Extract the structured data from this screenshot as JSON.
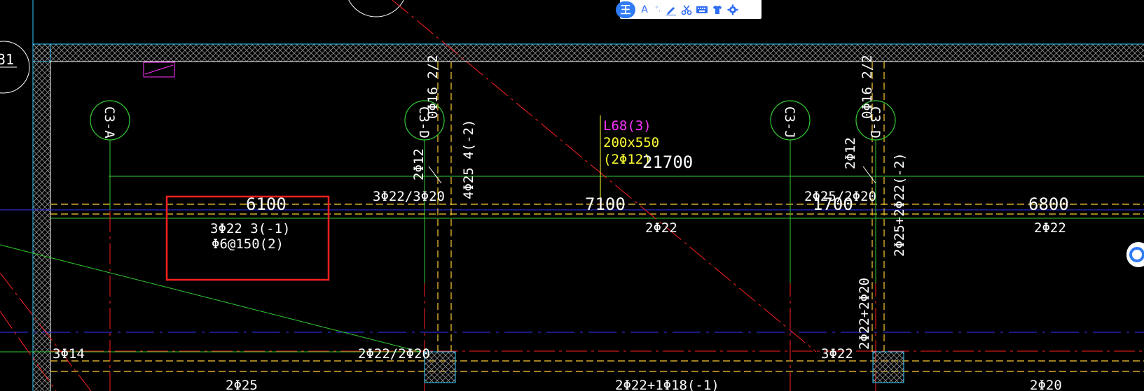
{
  "colors": {
    "background": "#000000",
    "wall": "#cfcfcf",
    "cyan": "#33ccff",
    "green": "#33cc33",
    "red": "#ff2020",
    "yellow": "#ffcc33",
    "white": "#ffffff",
    "magenta": "#ff33ff",
    "blue": "#3333ff",
    "highlight": "#ff2020"
  },
  "axis_labels": {
    "a1": "C3-A",
    "a2": "C3-D",
    "a3": "C3-J",
    "a4": "C3-D",
    "edge": "31"
  },
  "beam_label": {
    "name": "L68(3)",
    "size": "200x550",
    "rebar": "(2Φ12)",
    "length": "21700"
  },
  "spans": {
    "s1": "6100",
    "s2": "7100",
    "s3": "1700",
    "s4": "6800"
  },
  "texts": {
    "highlight_line1": "3Φ22 3(-1)",
    "highlight_line2": "Φ6@150(2)",
    "mid1": "3Φ22/3Φ20",
    "mid2": "2Φ25/2Φ20",
    "bottom_mid1": "2Φ22",
    "bottom_mid2": "2Φ22",
    "vert1": "0Φ16 2/2",
    "vert2": "4Φ25 4(-2)",
    "vert3": "2Φ12",
    "vert4": "0Φ16 2/2",
    "vert5": "2Φ12",
    "vert6": "2Φ25+2Φ22(-2)",
    "vert7": "2Φ22+2Φ20",
    "low1": "3Φ14",
    "low2": "2Φ22/2Φ20",
    "low3": "3Φ22",
    "bot1": "2Φ25",
    "bot2": "2Φ22+1Φ18(-1)",
    "bot3": "2Φ20"
  },
  "toolbar": {
    "logo": "王",
    "font_label": "A",
    "dot_label": "°,"
  },
  "icons": {
    "pen": "pen-icon",
    "scissors": "scissors-icon",
    "keyboard": "keyboard-icon",
    "shirt": "shirt-icon",
    "gear": "gear-icon"
  }
}
